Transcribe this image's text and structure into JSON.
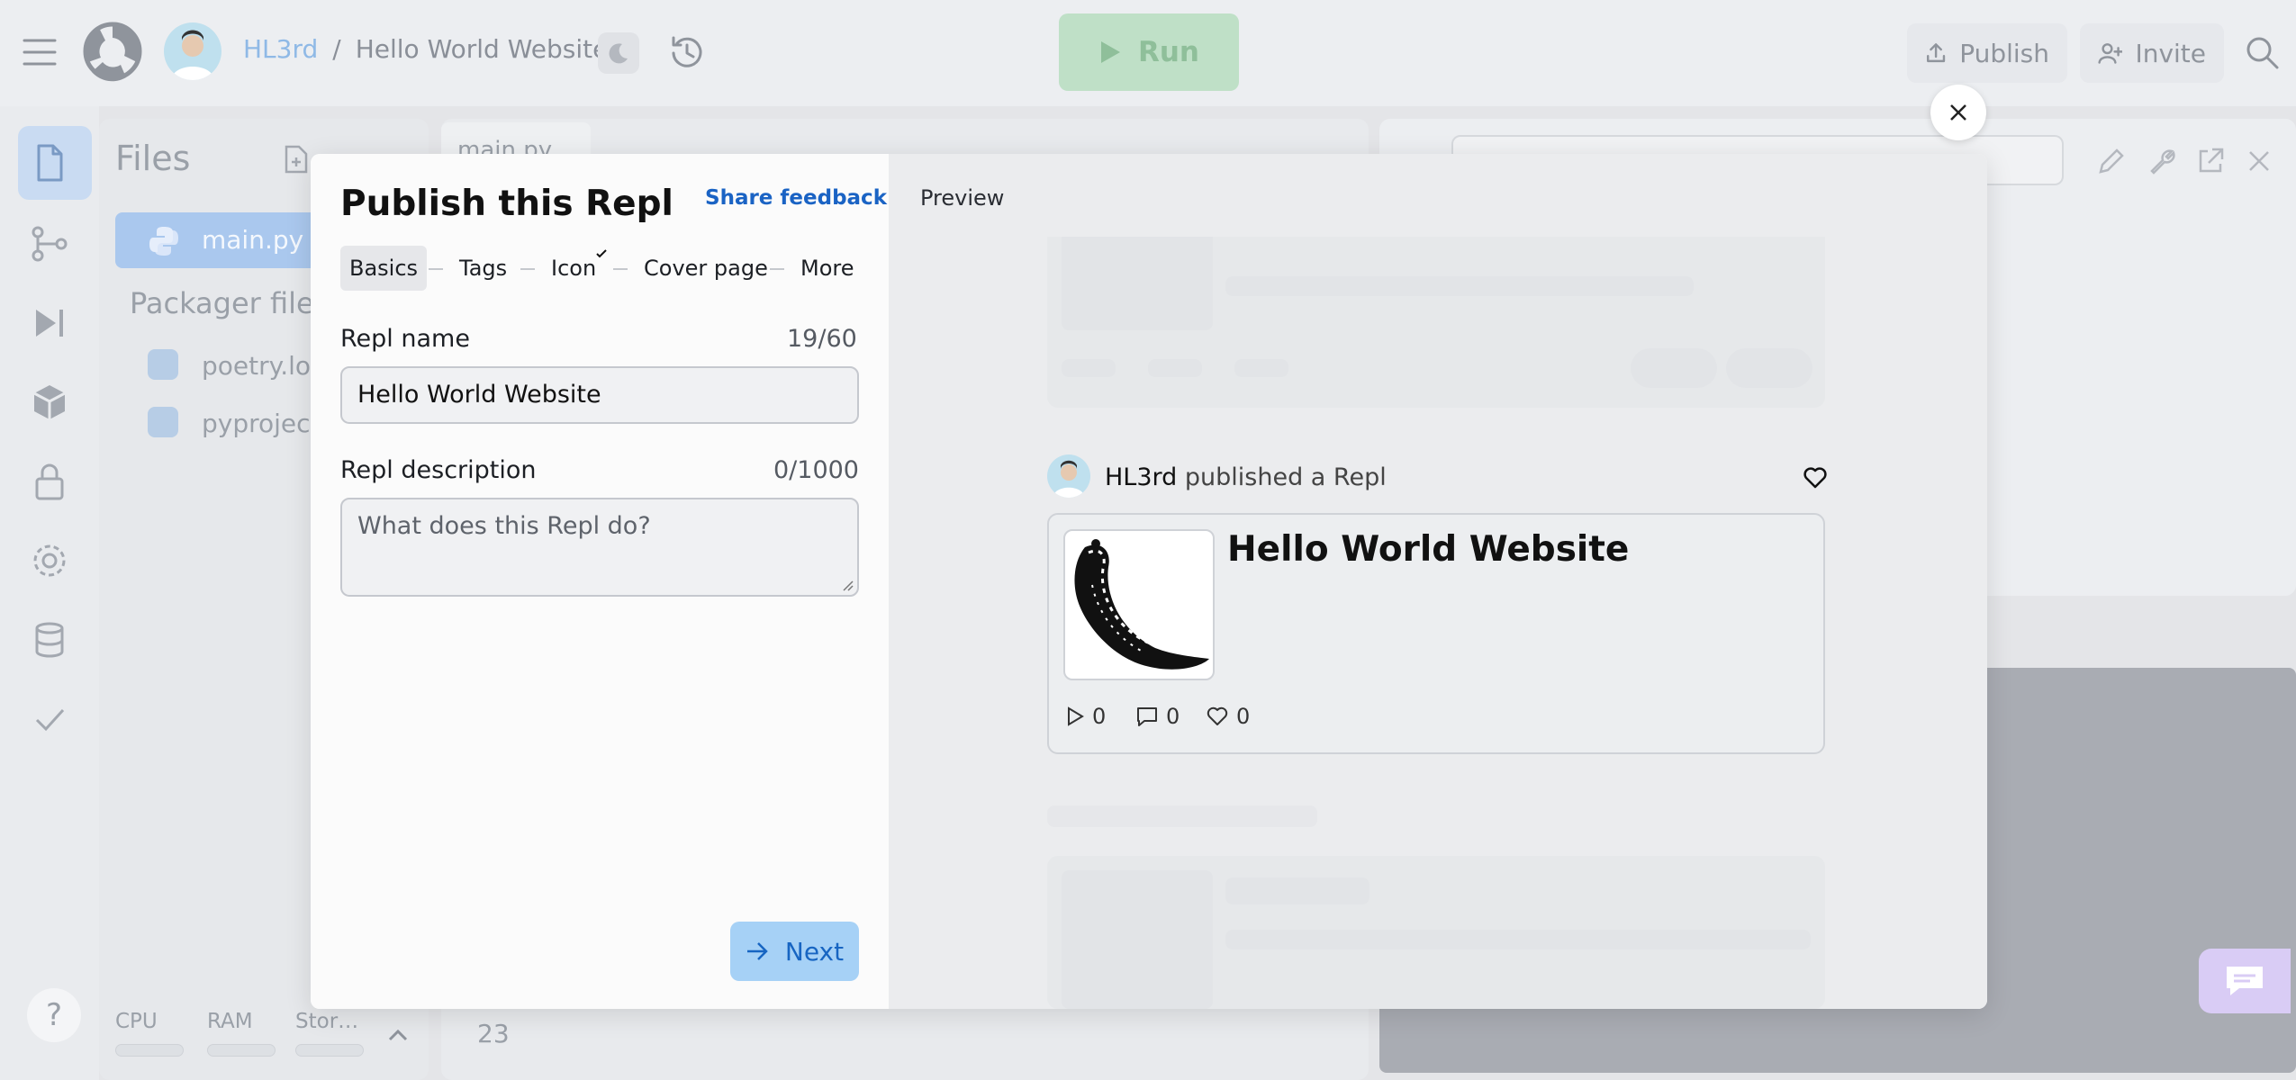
{
  "topbar": {
    "user": "HL3rd",
    "separator": "/",
    "project": "Hello World Website",
    "run_label": "Run",
    "publish_label": "Publish",
    "invite_label": "Invite"
  },
  "files": {
    "title": "Files",
    "items": [
      "main.py"
    ],
    "packager_heading": "Packager files",
    "packager_items": [
      "poetry.lock",
      "pyproject.toml"
    ],
    "resources": [
      "CPU",
      "RAM",
      "Storage"
    ]
  },
  "editor": {
    "tab": "main.py",
    "line_number": "23"
  },
  "modal": {
    "title": "Publish this Repl",
    "share_feedback": "Share feedback",
    "steps": [
      "Basics",
      "Tags",
      "Icon",
      "Cover page",
      "More"
    ],
    "name_label": "Repl name",
    "name_counter": "19/60",
    "name_value": "Hello World Website",
    "desc_label": "Repl description",
    "desc_counter": "0/1000",
    "desc_placeholder": "What does this Repl do?",
    "next_label": "Next"
  },
  "preview": {
    "label": "Preview",
    "author": "HL3rd",
    "action": "published a Repl",
    "card_title": "Hello World Website",
    "runs": "0",
    "comments": "0",
    "likes": "0"
  },
  "colors": {
    "accent": "#1a63c4",
    "run_green": "#bfe0c7",
    "next_blue": "#a6d1f6"
  }
}
